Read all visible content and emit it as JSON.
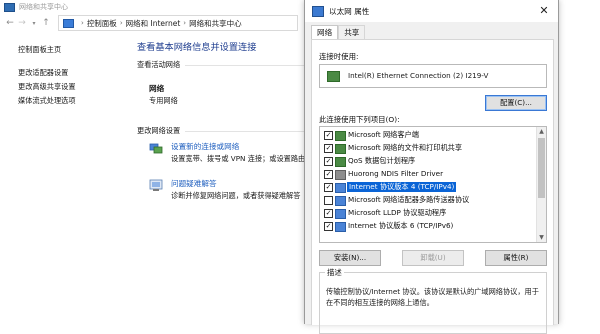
{
  "background_window": {
    "title": "网络和共享中心",
    "address": [
      "控制面板",
      "网络和 Internet",
      "网络和共享中心"
    ],
    "left_nav": [
      "控制面板主页",
      "更改适配器设置",
      "更改高级共享设置",
      "媒体流式处理选项"
    ],
    "main_title": "查看基本网络信息并设置连接",
    "active_networks_label": "查看活动网络",
    "network_name": "网络",
    "network_type": "专用网络",
    "change_settings_label": "更改网络设置",
    "tasks": [
      {
        "link": "设置新的连接或网络",
        "desc": "设置宽带、拨号或 VPN 连接；或设置路由"
      },
      {
        "link": "问题疑难解答",
        "desc": "诊断并修复网络问题，或者获得疑难解答"
      }
    ]
  },
  "dialog": {
    "title": "以太网 属性",
    "close_glyph": "✕",
    "tabs": [
      "网络",
      "共享"
    ],
    "connect_using_label": "连接时使用:",
    "adapter": "Intel(R) Ethernet Connection (2) I219-V",
    "configure_button": "配置(C)...",
    "components_label": "此连接使用下列项目(O):",
    "components": [
      {
        "label": "Microsoft 网络客户端",
        "checked": true,
        "icon": "network-client-icon"
      },
      {
        "label": "Microsoft 网络的文件和打印机共享",
        "checked": true,
        "icon": "file-share-icon"
      },
      {
        "label": "QoS 数据包计划程序",
        "checked": true,
        "icon": "qos-icon"
      },
      {
        "label": "Huorong NDIS Filter Driver",
        "checked": true,
        "icon": "filter-driver-icon"
      },
      {
        "label": "Internet 协议版本 4 (TCP/IPv4)",
        "checked": true,
        "icon": "protocol-icon",
        "selected": true
      },
      {
        "label": "Microsoft 网络适配器多路传送器协议",
        "checked": false,
        "icon": "protocol-icon"
      },
      {
        "label": "Microsoft LLDP 协议驱动程序",
        "checked": true,
        "icon": "protocol-icon"
      },
      {
        "label": "Internet 协议版本 6 (TCP/IPv6)",
        "checked": true,
        "icon": "protocol-icon"
      }
    ],
    "install_button": "安装(N)...",
    "uninstall_button": "卸载(U)",
    "properties_button": "属性(R)",
    "description_legend": "描述",
    "description_text": "传输控制协议/Internet 协议。该协议是默认的广域网络协议，用于在不同的相互连接的网络上通信。"
  },
  "colors": {
    "link": "#1f5fbf",
    "title_blue": "#1e3d8f",
    "selection": "#0a64d6"
  }
}
